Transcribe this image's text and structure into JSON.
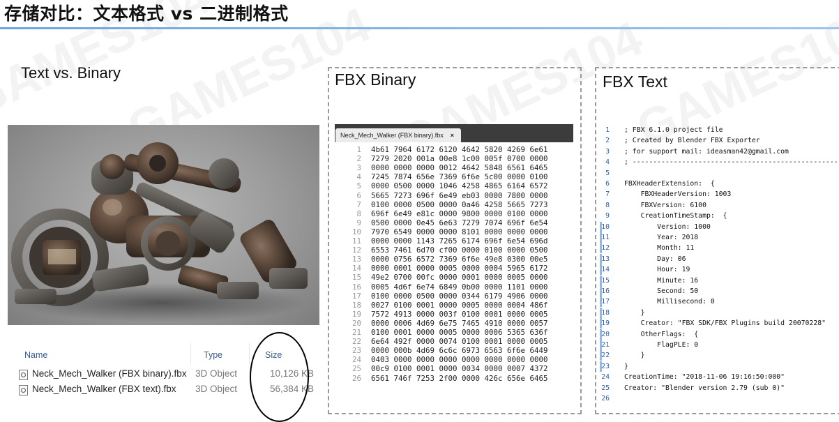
{
  "title": "存储对比：文本格式 vs 二进制格式",
  "watermark": "GAMES104",
  "left": {
    "heading": "Text vs. Binary",
    "explorer": {
      "columns": {
        "name": "Name",
        "type": "Type",
        "size": "Size"
      },
      "rows": [
        {
          "name": "Neck_Mech_Walker (FBX binary).fbx",
          "type": "3D Object",
          "size": "10,126 KB"
        },
        {
          "name": "Neck_Mech_Walker (FBX text).fbx",
          "type": "3D Object",
          "size": "56,384 KB"
        }
      ]
    }
  },
  "binary_panel": {
    "title": "FBX Binary",
    "tab_label": "Neck_Mech_Walker (FBX binary).fbx",
    "tab_close": "×",
    "lines": [
      "4b61 7964 6172 6120 4642 5820 4269 6e61",
      "7279 2020 001a 00e8 1c00 005f 0700 0000",
      "0000 0000 0000 0012 4642 5848 6561 6465",
      "7245 7874 656e 7369 6f6e 5c00 0000 0100",
      "0000 0500 0000 1046 4258 4865 6164 6572",
      "5665 7273 696f 6e49 eb03 0000 7800 0000",
      "0100 0000 0500 0000 0a46 4258 5665 7273",
      "696f 6e49 e81c 0000 9800 0000 0100 0000",
      "0500 0000 0e45 6e63 7279 7074 696f 6e54",
      "7970 6549 0000 0000 8101 0000 0000 0000",
      "0000 0000 1143 7265 6174 696f 6e54 696d",
      "6553 7461 6d70 cf00 0000 0100 0000 0500",
      "0000 0756 6572 7369 6f6e 49e8 0300 00e5",
      "0000 0001 0000 0005 0000 0004 5965 6172",
      "49e2 0700 00fc 0000 0001 0000 0005 0000",
      "0005 4d6f 6e74 6849 0b00 0000 1101 0000",
      "0100 0000 0500 0000 0344 6179 4906 0000",
      "0027 0100 0001 0000 0005 0000 0004 486f",
      "7572 4913 0000 003f 0100 0001 0000 0005",
      "0000 0006 4d69 6e75 7465 4910 0000 0057",
      "0100 0001 0000 0005 0000 0006 5365 636f",
      "6e64 492f 0000 0074 0100 0001 0000 0005",
      "0000 000b 4d69 6c6c 6973 6563 6f6e 6449",
      "0403 0000 0000 0000 0000 0000 0000 0000",
      "00c9 0100 0001 0000 0034 0000 0007 4372",
      "6561 746f 7253 2f00 0000 426c 656e 6465"
    ]
  },
  "text_panel": {
    "title": "FBX Text",
    "lines": [
      "; FBX 6.1.0 project file",
      "; Created by Blender FBX Exporter",
      "; for support mail: ideasman42@gmail.com",
      "; ----------------------------------------------------",
      "",
      "FBXHeaderExtension:  {",
      "    FBXHeaderVersion: 1003",
      "    FBXVersion: 6100",
      "    CreationTimeStamp:  {",
      "        Version: 1000",
      "        Year: 2018",
      "        Month: 11",
      "        Day: 06",
      "        Hour: 19",
      "        Minute: 16",
      "        Second: 50",
      "        Millisecond: 0",
      "    }",
      "    Creator: \"FBX SDK/FBX Plugins build 20070228\"",
      "    OtherFlags:  {",
      "        FlagPLE: 0",
      "    }",
      "}",
      "CreationTime: \"2018-11-06 19:16:50:000\"",
      "Creator: \"Blender version 2.79 (sub 0)\"",
      ""
    ]
  }
}
